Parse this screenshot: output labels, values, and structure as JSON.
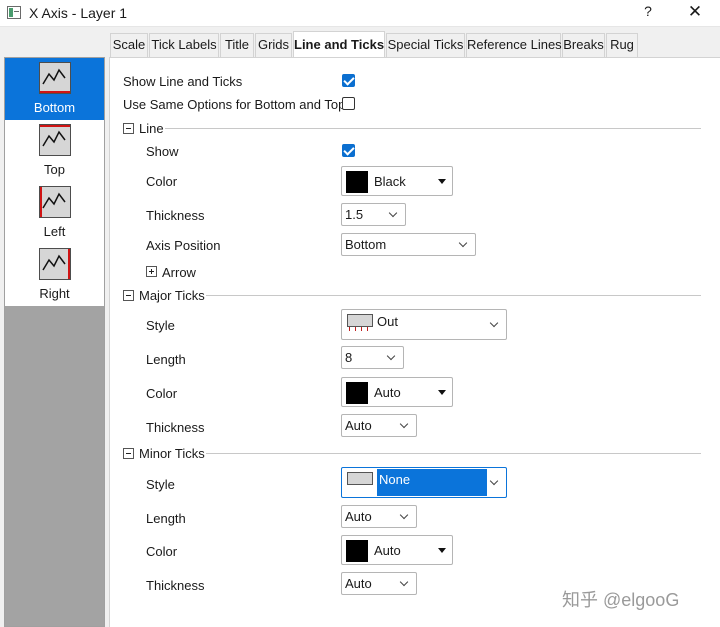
{
  "window": {
    "title": "X Axis - Layer 1",
    "help": "?",
    "close": "✕"
  },
  "tabs": [
    "Scale",
    "Tick Labels",
    "Title",
    "Grids",
    "Line and Ticks",
    "Special Ticks",
    "Reference Lines",
    "Breaks",
    "Rug"
  ],
  "active_tab": "Line and Ticks",
  "sidebar": {
    "items": [
      {
        "label": "Bottom",
        "selected": true
      },
      {
        "label": "Top",
        "selected": false
      },
      {
        "label": "Left",
        "selected": false
      },
      {
        "label": "Right",
        "selected": false
      }
    ]
  },
  "general": {
    "show_line_label": "Show Line and Ticks",
    "show_line_checked": true,
    "same_options_label": "Use Same Options for Bottom and Top",
    "same_options_checked": false
  },
  "line": {
    "header": "Line",
    "expanded": true,
    "show_label": "Show",
    "show_checked": true,
    "color_label": "Color",
    "color_value": "Black",
    "color_swatch": "#000000",
    "thickness_label": "Thickness",
    "thickness_value": "1.5",
    "axis_position_label": "Axis Position",
    "axis_position_value": "Bottom",
    "arrow_label": "Arrow",
    "arrow_expanded": false
  },
  "major_ticks": {
    "header": "Major Ticks",
    "expanded": true,
    "style_label": "Style",
    "style_value": "Out",
    "length_label": "Length",
    "length_value": "8",
    "color_label": "Color",
    "color_value": "Auto",
    "color_swatch": "#000000",
    "thickness_label": "Thickness",
    "thickness_value": "Auto"
  },
  "minor_ticks": {
    "header": "Minor Ticks",
    "expanded": true,
    "style_label": "Style",
    "style_value": "None",
    "length_label": "Length",
    "length_value": "Auto",
    "color_label": "Color",
    "color_value": "Auto",
    "color_swatch": "#000000",
    "thickness_label": "Thickness",
    "thickness_value": "Auto"
  },
  "watermark": "知乎 @elgooG",
  "colors": {
    "accent": "#0b74da",
    "checkbox": "#0b6fd0",
    "tick_red": "#d01414"
  }
}
